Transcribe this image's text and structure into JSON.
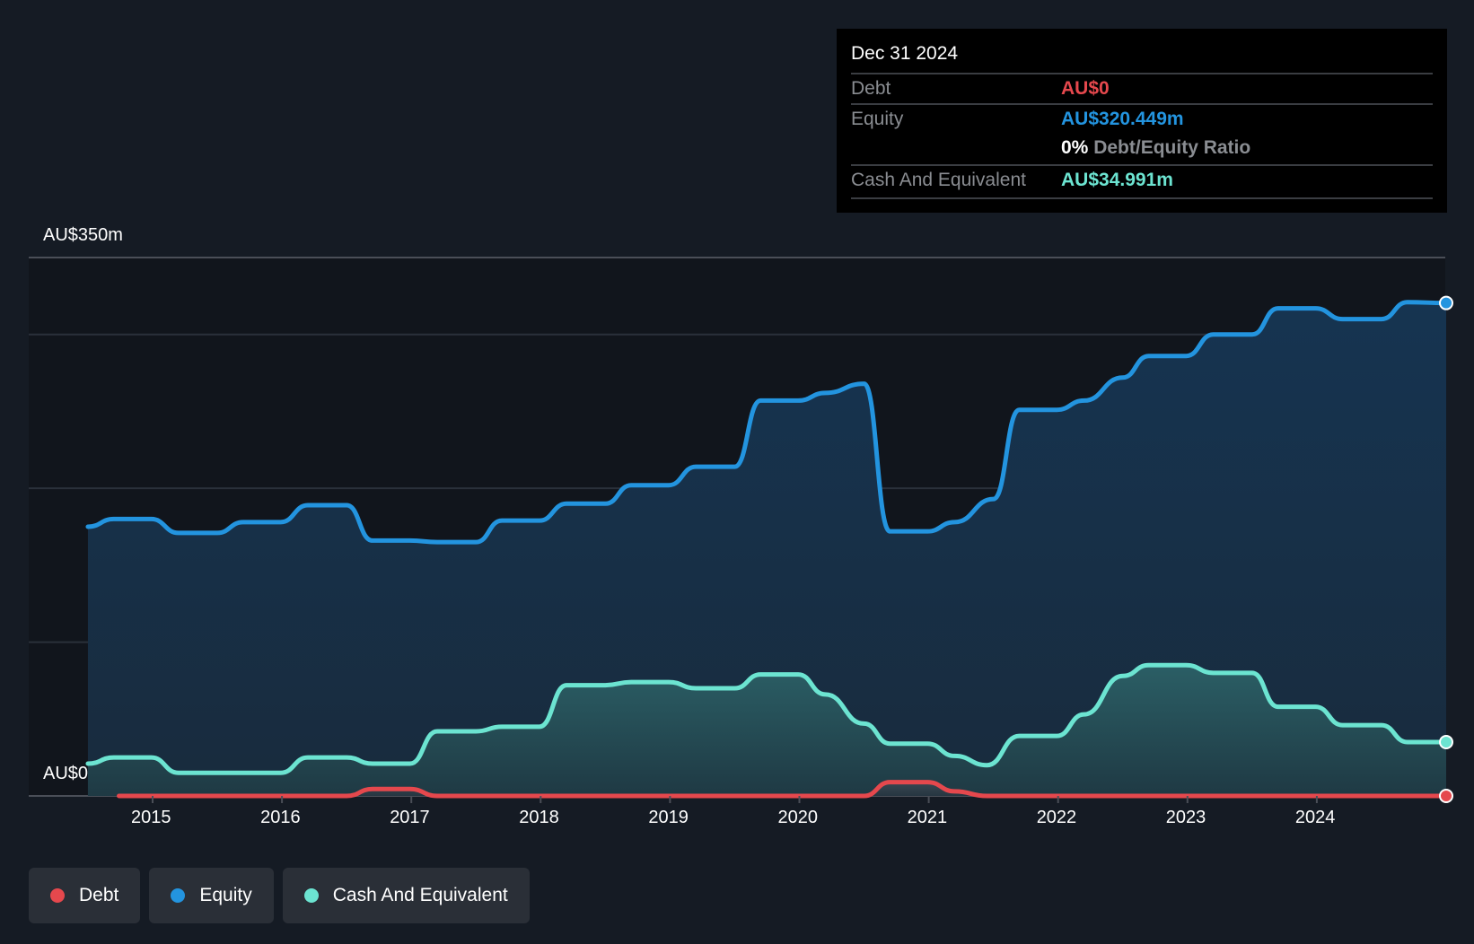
{
  "tooltip": {
    "date": "Dec 31 2024",
    "rows": [
      {
        "label": "Debt",
        "value": "AU$0",
        "color": "#e5484d"
      },
      {
        "label": "Equity",
        "value": "AU$320.449m",
        "color": "#2394df"
      },
      {
        "label": "",
        "ratio_pct": "0%",
        "ratio_label": "Debt/Equity Ratio"
      },
      {
        "label": "Cash And Equivalent",
        "value": "AU$34.991m",
        "color": "#6ce4d1"
      }
    ]
  },
  "legend": [
    {
      "label": "Debt",
      "color": "#e5484d"
    },
    {
      "label": "Equity",
      "color": "#2394df"
    },
    {
      "label": "Cash And Equivalent",
      "color": "#6ce4d1"
    }
  ],
  "chart_data": {
    "type": "area",
    "title": "",
    "xlabel": "",
    "ylabel": "",
    "y_unit": "AU$ m",
    "ylim": [
      0,
      350
    ],
    "xlim": [
      2014.5,
      2025.0
    ],
    "y_tick_labels": [
      {
        "value": 350,
        "label": "AU$350m"
      },
      {
        "value": 0,
        "label": "AU$0"
      }
    ],
    "gridlines": [
      100,
      200,
      300,
      350
    ],
    "x_ticks": [
      2015,
      2016,
      2017,
      2018,
      2019,
      2020,
      2021,
      2022,
      2023,
      2024
    ],
    "x_tick_labels": [
      "2015",
      "2016",
      "2017",
      "2018",
      "2019",
      "2020",
      "2021",
      "2022",
      "2023",
      "2024"
    ],
    "legend_position": "bottom-left",
    "series": [
      {
        "name": "Equity",
        "color": "#2394df",
        "points": [
          [
            2014.5,
            175
          ],
          [
            2014.7,
            180
          ],
          [
            2014.99,
            180
          ],
          [
            2015.2,
            171
          ],
          [
            2015.5,
            171
          ],
          [
            2015.7,
            178
          ],
          [
            2015.99,
            178
          ],
          [
            2016.2,
            189
          ],
          [
            2016.5,
            189
          ],
          [
            2016.7,
            166
          ],
          [
            2016.99,
            166
          ],
          [
            2017.2,
            165
          ],
          [
            2017.5,
            165
          ],
          [
            2017.7,
            179
          ],
          [
            2017.99,
            179
          ],
          [
            2018.2,
            190
          ],
          [
            2018.5,
            190
          ],
          [
            2018.7,
            202
          ],
          [
            2018.99,
            202
          ],
          [
            2019.2,
            214
          ],
          [
            2019.5,
            214
          ],
          [
            2019.7,
            257
          ],
          [
            2019.99,
            257
          ],
          [
            2020.2,
            262
          ],
          [
            2020.5,
            268
          ],
          [
            2020.7,
            172
          ],
          [
            2020.99,
            172
          ],
          [
            2021.2,
            178
          ],
          [
            2021.5,
            193
          ],
          [
            2021.7,
            251
          ],
          [
            2021.99,
            251
          ],
          [
            2022.2,
            257
          ],
          [
            2022.5,
            272
          ],
          [
            2022.7,
            286
          ],
          [
            2022.99,
            286
          ],
          [
            2023.2,
            300
          ],
          [
            2023.5,
            300
          ],
          [
            2023.7,
            317
          ],
          [
            2023.99,
            317
          ],
          [
            2024.2,
            310
          ],
          [
            2024.5,
            310
          ],
          [
            2024.7,
            321
          ],
          [
            2025.0,
            320.449
          ]
        ]
      },
      {
        "name": "Cash And Equivalent",
        "color": "#6ce4d1",
        "points": [
          [
            2014.5,
            21
          ],
          [
            2014.7,
            25
          ],
          [
            2014.99,
            25
          ],
          [
            2015.2,
            15
          ],
          [
            2015.5,
            15
          ],
          [
            2015.99,
            15
          ],
          [
            2016.2,
            25
          ],
          [
            2016.5,
            25
          ],
          [
            2016.7,
            21
          ],
          [
            2016.99,
            21
          ],
          [
            2017.2,
            42
          ],
          [
            2017.5,
            42
          ],
          [
            2017.7,
            45
          ],
          [
            2017.99,
            45
          ],
          [
            2018.2,
            72
          ],
          [
            2018.5,
            72
          ],
          [
            2018.7,
            74
          ],
          [
            2018.99,
            74
          ],
          [
            2019.2,
            70
          ],
          [
            2019.5,
            70
          ],
          [
            2019.7,
            79
          ],
          [
            2019.99,
            79
          ],
          [
            2020.2,
            66
          ],
          [
            2020.5,
            47
          ],
          [
            2020.7,
            34
          ],
          [
            2020.99,
            34
          ],
          [
            2021.2,
            26
          ],
          [
            2021.45,
            20
          ],
          [
            2021.7,
            39
          ],
          [
            2021.99,
            39
          ],
          [
            2022.2,
            53
          ],
          [
            2022.5,
            78
          ],
          [
            2022.7,
            85
          ],
          [
            2022.99,
            85
          ],
          [
            2023.2,
            80
          ],
          [
            2023.5,
            80
          ],
          [
            2023.7,
            58
          ],
          [
            2023.99,
            58
          ],
          [
            2024.2,
            46
          ],
          [
            2024.5,
            46
          ],
          [
            2024.7,
            35
          ],
          [
            2025.0,
            34.991
          ]
        ]
      },
      {
        "name": "Debt",
        "color": "#e5484d",
        "points": [
          [
            2014.74,
            0
          ],
          [
            2016.5,
            0
          ],
          [
            2016.7,
            4.5
          ],
          [
            2016.99,
            4.5
          ],
          [
            2017.2,
            0
          ],
          [
            2020.5,
            0
          ],
          [
            2020.7,
            9
          ],
          [
            2020.99,
            9
          ],
          [
            2021.2,
            3
          ],
          [
            2021.45,
            0
          ],
          [
            2025.0,
            0
          ]
        ]
      }
    ]
  }
}
